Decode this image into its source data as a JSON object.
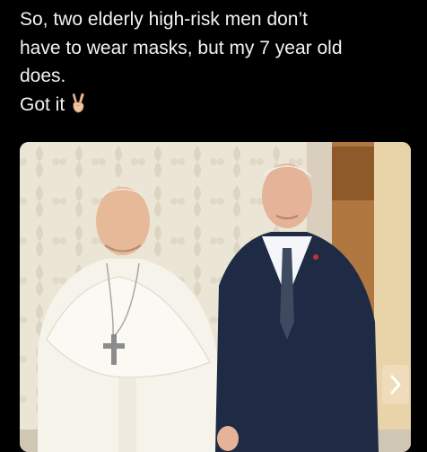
{
  "tweet": {
    "lines": [
      "So, two elderly high-risk men don’t",
      "have to wear masks, but my 7 year old",
      "does.",
      "Got it"
    ],
    "emoji": "victory-hand-emoji"
  },
  "media": {
    "description_icon": "photo",
    "next_icon": "chevron-right-icon"
  }
}
